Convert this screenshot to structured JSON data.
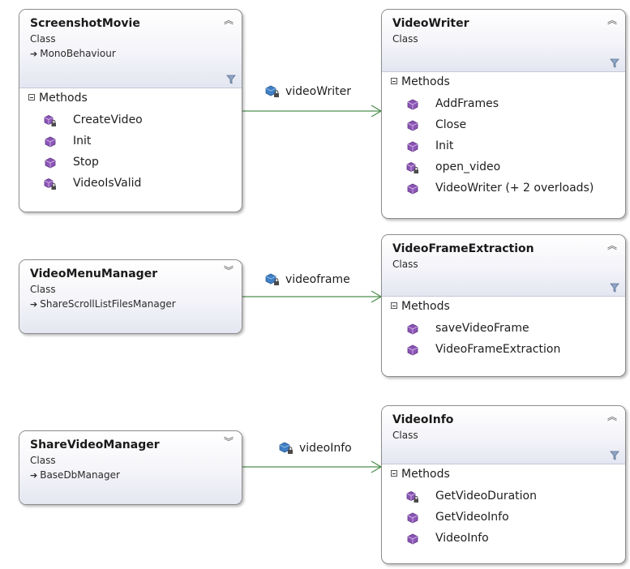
{
  "colors": {
    "method_icon": "#8b55b5",
    "field_icon": "#3f7fc4",
    "lock": "#4a4a4a",
    "connector": "#4e8f4e"
  },
  "classes": {
    "screenshot_movie": {
      "name": "ScreenshotMovie",
      "kind": "Class",
      "base": "MonoBehaviour",
      "section": "Methods",
      "methods": [
        {
          "name": "CreateVideo",
          "icon": "private-method-icon"
        },
        {
          "name": "Init",
          "icon": "method-icon"
        },
        {
          "name": "Stop",
          "icon": "method-icon"
        },
        {
          "name": "VideoIsValid",
          "icon": "private-method-icon"
        }
      ]
    },
    "video_writer": {
      "name": "VideoWriter",
      "kind": "Class",
      "section": "Methods",
      "methods": [
        {
          "name": "AddFrames",
          "icon": "method-icon"
        },
        {
          "name": "Close",
          "icon": "method-icon"
        },
        {
          "name": "Init",
          "icon": "method-icon"
        },
        {
          "name": "open_video",
          "icon": "private-method-icon"
        },
        {
          "name": "VideoWriter (+ 2 overloads)",
          "icon": "method-icon"
        }
      ]
    },
    "video_menu_manager": {
      "name": "VideoMenuManager",
      "kind": "Class",
      "base": "ShareScrollListFilesManager"
    },
    "video_frame_extraction": {
      "name": "VideoFrameExtraction",
      "kind": "Class",
      "section": "Methods",
      "methods": [
        {
          "name": "saveVideoFrame",
          "icon": "method-icon"
        },
        {
          "name": "VideoFrameExtraction",
          "icon": "method-icon"
        }
      ]
    },
    "share_video_manager": {
      "name": "ShareVideoManager",
      "kind": "Class",
      "base": "BaseDbManager"
    },
    "video_info": {
      "name": "VideoInfo",
      "kind": "Class",
      "section": "Methods",
      "methods": [
        {
          "name": "GetVideoDuration",
          "icon": "private-method-icon"
        },
        {
          "name": "GetVideoInfo",
          "icon": "method-icon"
        },
        {
          "name": "VideoInfo",
          "icon": "method-icon"
        }
      ]
    }
  },
  "associations": {
    "video_writer": "videoWriter",
    "videoframe": "videoframe",
    "video_info": "videoInfo"
  }
}
